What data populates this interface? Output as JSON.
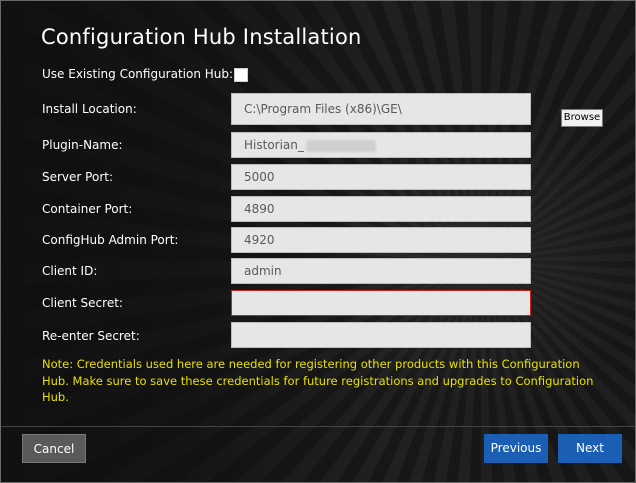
{
  "window": {
    "title": "Configuration Hub Installation"
  },
  "form": {
    "use_existing_label": "Use Existing Configuration Hub:",
    "use_existing_checked": false,
    "install_location_label": "Install Location:",
    "install_location_value": "C:\\Program Files (x86)\\GE\\",
    "browse_label": "Browse",
    "plugin_name_label": "Plugin-Name:",
    "plugin_name_value": "Historian_",
    "server_port_label": "Server Port:",
    "server_port_value": "5000",
    "container_port_label": "Container Port:",
    "container_port_value": "4890",
    "confighub_admin_port_label": "ConfigHub Admin Port:",
    "confighub_admin_port_value": "4920",
    "client_id_label": "Client ID:",
    "client_id_value": "admin",
    "client_secret_label": "Client Secret:",
    "client_secret_value": "",
    "reenter_secret_label": "Re-enter Secret:",
    "reenter_secret_value": ""
  },
  "note": {
    "text": "Note: Credentials used here are needed for registering other products with this Configuration Hub. Make sure to save these credentials for future registrations and upgrades to Configuration Hub."
  },
  "footer": {
    "cancel_label": "Cancel",
    "previous_label": "Previous",
    "next_label": "Next"
  },
  "colors": {
    "primary_button": "#1a5fb4",
    "note_text": "#e8e000",
    "error_border": "#d02020"
  }
}
